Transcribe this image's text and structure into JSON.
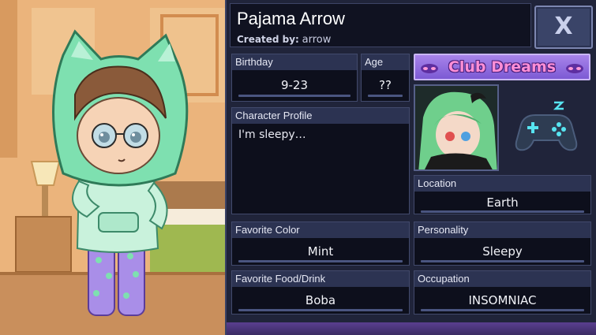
{
  "character": {
    "name": "Pajama Arrow",
    "created_by_label": "Created by:",
    "created_by": "arrow"
  },
  "close_button": {
    "label": "X"
  },
  "fields": {
    "birthday": {
      "label": "Birthday",
      "value": "9-23"
    },
    "age": {
      "label": "Age",
      "value": "??"
    },
    "profile": {
      "label": "Character Profile",
      "value": "I'm sleepy…"
    },
    "location": {
      "label": "Location",
      "value": "Earth"
    },
    "favorite_color": {
      "label": "Favorite Color",
      "value": "Mint"
    },
    "personality": {
      "label": "Personality",
      "value": "Sleepy"
    },
    "favorite_food": {
      "label": "Favorite Food/Drink",
      "value": "Boba"
    },
    "occupation": {
      "label": "Occupation",
      "value": "INSOMNIAC"
    }
  },
  "club": {
    "name": "Club Dreams"
  },
  "icons": {
    "close": "close-icon",
    "gamepad": "gamepad-icon",
    "sleep": "zzz-icon"
  },
  "colors": {
    "panel_bg": "#20243a",
    "label_bg": "#2c3352",
    "value_bg": "#0d0f1c",
    "club_banner": "#8a66de",
    "club_text": "#ff8fd6",
    "hoodie": "#7ee0b0",
    "pants": "#a98ee8"
  }
}
